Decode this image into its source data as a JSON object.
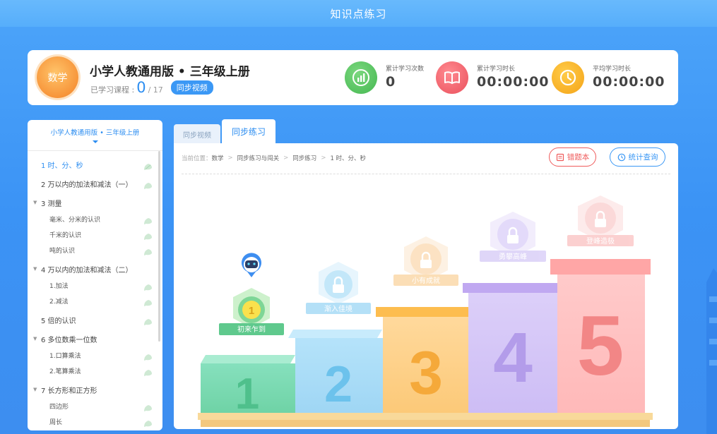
{
  "page": {
    "title": "知识点练习"
  },
  "header": {
    "subject": "数学",
    "book_title": "小学人教通用版 • 三年级上册",
    "progress_label": "已学习课程 :",
    "progress_done": "0",
    "progress_total": "/ 17",
    "sync_video_label": "同步视频",
    "stats": [
      {
        "label": "累计学习次数",
        "value": "0",
        "color": "#4cc05a",
        "icon": "bar-chart-icon"
      },
      {
        "label": "累计学习时长",
        "value": "00:00:00",
        "color": "#f0606c",
        "icon": "book-icon"
      },
      {
        "label": "平均学习时长",
        "value": "00:00:00",
        "color": "#f7a51d",
        "icon": "clock-icon"
      }
    ]
  },
  "sidebar": {
    "title": "小学人教通用版 • 三年级上册",
    "items": [
      {
        "label": "1 时、分、秒",
        "level": 1,
        "active": true,
        "expanded": false
      },
      {
        "label": "2 万以内的加法和减法（一）",
        "level": 1,
        "active": false
      },
      {
        "label": "3 测量",
        "level": 1,
        "expandable": true
      },
      {
        "label": "毫米、分米的认识",
        "level": 2
      },
      {
        "label": "千米的认识",
        "level": 2
      },
      {
        "label": "吨的认识",
        "level": 2
      },
      {
        "label": "4 万以内的加法和减法（二）",
        "level": 1,
        "expandable": true
      },
      {
        "label": "1.加法",
        "level": 2
      },
      {
        "label": "2.减法",
        "level": 2
      },
      {
        "label": "5 倍的认识",
        "level": 1
      },
      {
        "label": "6 多位数乘一位数",
        "level": 1,
        "expandable": true
      },
      {
        "label": "1.口算乘法",
        "level": 2
      },
      {
        "label": "2.笔算乘法",
        "level": 2
      },
      {
        "label": "7 长方形和正方形",
        "level": 1,
        "expandable": true
      },
      {
        "label": "四边形",
        "level": 2
      },
      {
        "label": "周长",
        "level": 2
      }
    ]
  },
  "tabs": [
    {
      "label": "同步视频",
      "active": false
    },
    {
      "label": "同步练习",
      "active": true
    }
  ],
  "breadcrumb": {
    "prefix": "当前位置：",
    "parts": [
      "数学",
      "同步练习与闯关",
      "同步练习",
      "1 时、分、秒"
    ]
  },
  "actions": {
    "wrong_book": "错题本",
    "stats_query": "统计查询"
  },
  "podium": {
    "levels": [
      {
        "number": "1",
        "badge": "初来乍到",
        "color": "#7fdcb4",
        "badge_color": "#58c98a",
        "unlocked": true
      },
      {
        "number": "2",
        "badge": "渐入佳境",
        "color": "#a9dcf7",
        "badge_color": "#8fcff1",
        "unlocked": false
      },
      {
        "number": "3",
        "badge": "小有成就",
        "color": "#ffd38e",
        "badge_color": "#fbd7a5",
        "unlocked": false
      },
      {
        "number": "4",
        "badge": "勇攀高峰",
        "color": "#d4c6f8",
        "badge_color": "#d8cdf7",
        "unlocked": false
      },
      {
        "number": "5",
        "badge": "登峰造极",
        "color": "#ffc2c2",
        "badge_color": "#fbc5c5",
        "unlocked": false
      }
    ]
  }
}
